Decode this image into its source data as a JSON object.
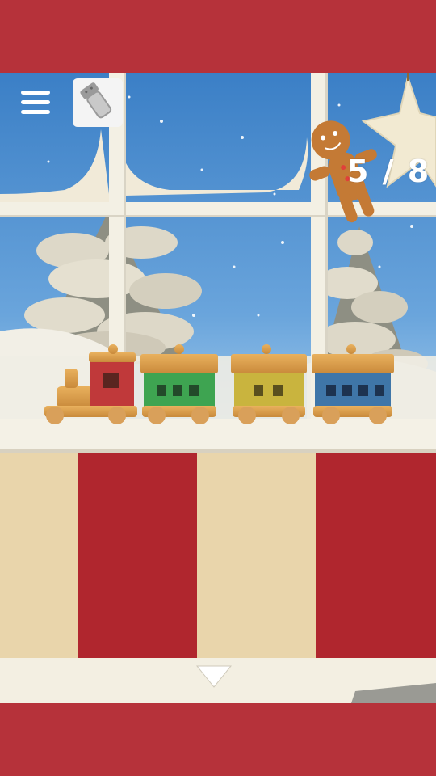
{
  "hud": {
    "menu_icon": "hamburger-menu-icon",
    "item_icon": "salt-shaker-icon",
    "gingerbread_found": "5",
    "gingerbread_total": "8",
    "counter_text": "5 / 8",
    "down_icon": "down-arrow-icon"
  },
  "colors": {
    "frame_red": "#b6323a",
    "stripe_red": "#b0262e",
    "stripe_beige": "#e8d3a9",
    "sky_blue": "#4e8fcf",
    "window_frame": "#f3f0e4"
  },
  "scene": {
    "train_cars": [
      "engine-red",
      "car-green",
      "car-yellow",
      "car-blue"
    ]
  }
}
